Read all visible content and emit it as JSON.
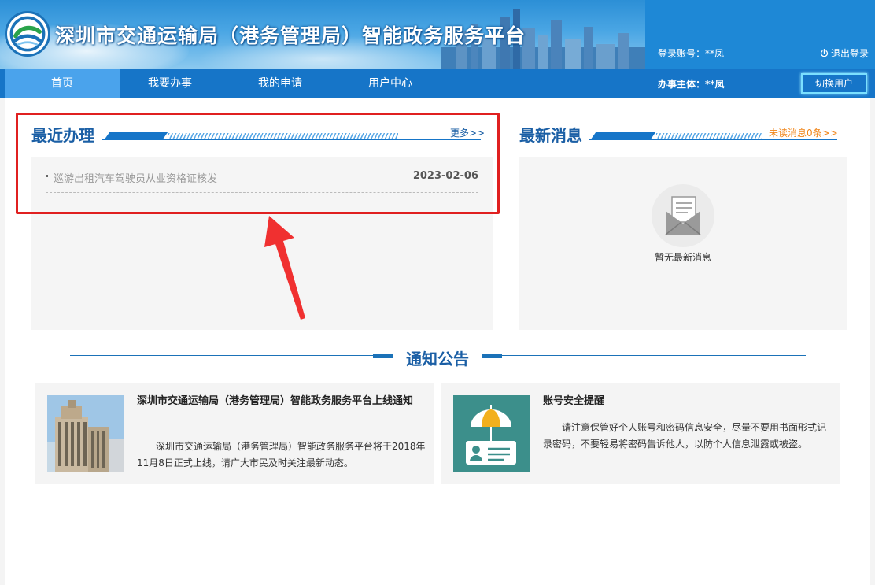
{
  "header": {
    "logo_text": "深圳市交通运输局",
    "title": "深圳市交通运输局（港务管理局）智能政务服务平台",
    "account_label": "登录账号：**凤",
    "logout_label": "退出登录",
    "logout_icon": "power-icon"
  },
  "nav": {
    "items": [
      {
        "label": "首页",
        "active": true
      },
      {
        "label": "我要办事",
        "active": false
      },
      {
        "label": "我的申请",
        "active": false
      },
      {
        "label": "用户中心",
        "active": false
      }
    ],
    "subject_label": "办事主体：**凤",
    "switch_user_label": "切换用户"
  },
  "recent": {
    "title": "最近办理",
    "more_label": "更多>>",
    "items": [
      {
        "name": "巡游出租汽车驾驶员从业资格证核发",
        "date": "2023-02-06"
      }
    ]
  },
  "messages": {
    "title": "最新消息",
    "unread_label": "未读消息0条>>",
    "empty_text": "暂无最新消息",
    "empty_icon": "envelope-icon"
  },
  "notice": {
    "title": "通知公告",
    "cards": [
      {
        "title": "深圳市交通运输局（港务管理局）智能政务服务平台上线通知",
        "body": "深圳市交通运输局（港务管理局）智能政务服务平台将于2018年11月8日正式上线，请广大市民及时关注最新动态。",
        "image": "building-photo"
      },
      {
        "title": "账号安全提醒",
        "body": "请注意保管好个人账号和密码信息安全，尽量不要用书面形式记录密码，不要轻易将密码告诉他人，以防个人信息泄露或被盗。",
        "image": "umbrella-id-card-icon"
      }
    ]
  },
  "colors": {
    "nav_bg": "#1675c8",
    "nav_active": "#4aa3ec",
    "title_blue": "#1b5fa5",
    "highlight_red": "#e02020",
    "unread_orange": "#f08519"
  }
}
